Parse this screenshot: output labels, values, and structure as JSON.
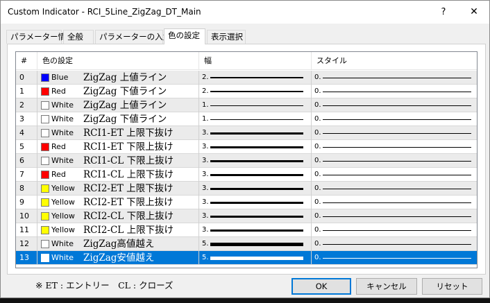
{
  "window": {
    "title": "Custom Indicator - RCI_5Line_ZigZag_DT_Main",
    "help": "?",
    "close": "✕"
  },
  "tabs": [
    {
      "label": "パラメーター情報",
      "active": false
    },
    {
      "label": "全般",
      "active": false
    },
    {
      "label": "パラメーターの入力",
      "active": false
    },
    {
      "label": "色の設定",
      "active": true
    },
    {
      "label": "表示選択",
      "active": false
    }
  ],
  "table": {
    "headers": {
      "num": "#",
      "color": "色の設定",
      "width": "幅",
      "style": "スタイル"
    },
    "rows": [
      {
        "num": "0",
        "color_name": "Blue",
        "swatch": "#0000ff",
        "label": "ZigZag 上値ライン",
        "width": "2.",
        "style": "0."
      },
      {
        "num": "1",
        "color_name": "Red",
        "swatch": "#ff0000",
        "label": "ZigZag 下値ライン",
        "width": "2.",
        "style": "0."
      },
      {
        "num": "2",
        "color_name": "White",
        "swatch": "#ffffff",
        "label": "ZigZag 上値ライン",
        "width": "1.",
        "style": "0."
      },
      {
        "num": "3",
        "color_name": "White",
        "swatch": "#ffffff",
        "label": "ZigZag 下値ライン",
        "width": "1.",
        "style": "0."
      },
      {
        "num": "4",
        "color_name": "White",
        "swatch": "#ffffff",
        "label": "RCI1-ET 上限下抜け",
        "width": "3.",
        "style": "0."
      },
      {
        "num": "5",
        "color_name": "Red",
        "swatch": "#ff0000",
        "label": "RCI1-ET 下限上抜け",
        "width": "3.",
        "style": "0."
      },
      {
        "num": "6",
        "color_name": "White",
        "swatch": "#ffffff",
        "label": "RCI1-CL 下限上抜け",
        "width": "3.",
        "style": "0."
      },
      {
        "num": "7",
        "color_name": "Red",
        "swatch": "#ff0000",
        "label": "RCI1-CL 上限下抜け",
        "width": "3.",
        "style": "0."
      },
      {
        "num": "8",
        "color_name": "Yellow",
        "swatch": "#ffff00",
        "label": "RCI2-ET 上限下抜け",
        "width": "3.",
        "style": "0."
      },
      {
        "num": "9",
        "color_name": "Yellow",
        "swatch": "#ffff00",
        "label": "RCI2-ET 下限上抜け",
        "width": "3.",
        "style": "0."
      },
      {
        "num": "10",
        "color_name": "Yellow",
        "swatch": "#ffff00",
        "label": "RCI2-CL 下限上抜け",
        "width": "3.",
        "style": "0."
      },
      {
        "num": "11",
        "color_name": "Yellow",
        "swatch": "#ffff00",
        "label": "RCI2-CL 上限下抜け",
        "width": "3.",
        "style": "0."
      },
      {
        "num": "12",
        "color_name": "White",
        "swatch": "#ffffff",
        "label": "ZigZag高値越え",
        "width": "5.",
        "style": "0."
      },
      {
        "num": "13",
        "color_name": "White",
        "swatch": "#ffffff",
        "label": "ZigZag安値越え",
        "width": "5.",
        "style": "0.",
        "selected": true
      }
    ]
  },
  "footnote": "※ ET : エントリー　CL : クローズ",
  "buttons": {
    "ok": "OK",
    "cancel": "キャンセル",
    "reset": "リセット"
  },
  "colors": {
    "accent": "#0078d7",
    "row_alt": "#ebebeb"
  }
}
